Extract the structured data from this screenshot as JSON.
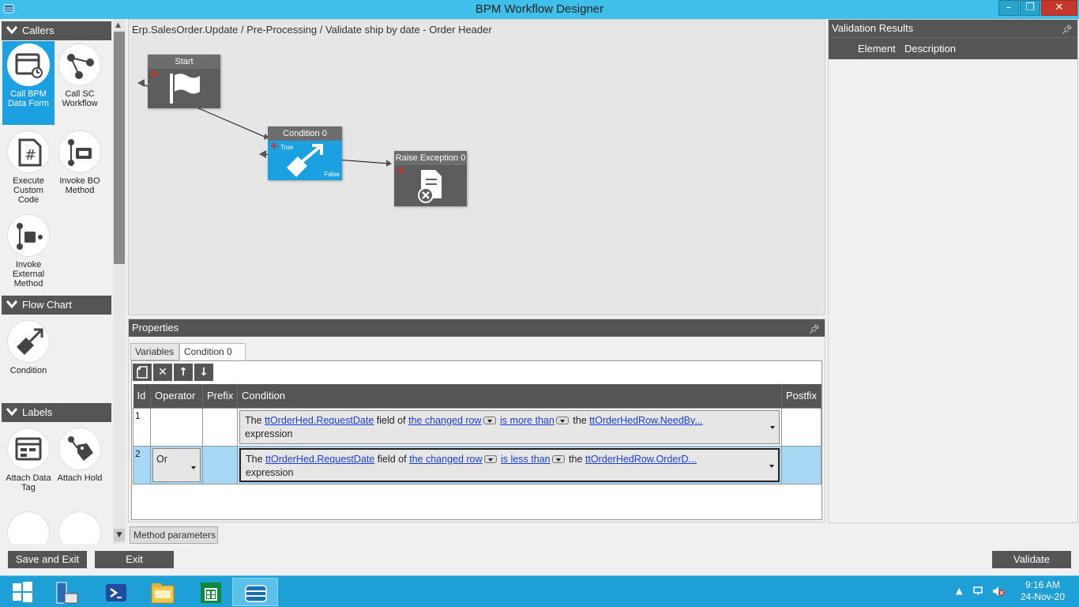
{
  "window": {
    "title": "BPM Workflow Designer",
    "min": "–",
    "max": "❐",
    "close": "✕"
  },
  "toolbox": {
    "sections": [
      {
        "label": "Callers"
      },
      {
        "label": "Flow Chart"
      },
      {
        "label": "Labels"
      }
    ],
    "tools": {
      "call_bpm": "Call BPM Data Form",
      "call_sc": "Call SC Workflow",
      "execute_code": "Execute Custom Code",
      "invoke_bo": "Invoke BO Method",
      "invoke_ext": "Invoke External Method",
      "condition": "Condition",
      "attach_tag": "Attach Data Tag",
      "attach_hold": "Attach Hold"
    }
  },
  "canvas": {
    "breadcrumb": "Erp.SalesOrder.Update / Pre-Processing / Validate ship by date - Order Header",
    "nodes": {
      "start": "Start",
      "condition": "Condition 0",
      "condition_true": "True",
      "condition_false": "False",
      "raise": "Raise Exception 0"
    }
  },
  "properties": {
    "title": "Properties",
    "tabs": [
      "Variables",
      "Condition 0"
    ],
    "columns": [
      "Id",
      "Operator",
      "Prefix",
      "Condition",
      "Postfix"
    ],
    "rows": [
      {
        "id": "1",
        "operator": "",
        "prefix": "",
        "t1": "The",
        "field": "ttOrderHed.RequestDate",
        "t2": "field of",
        "row": "the changed row",
        "cmp": "is more than",
        "t3": "the",
        "expr": "ttOrderHedRow.NeedBy...",
        "t4": "expression",
        "postfix": ""
      },
      {
        "id": "2",
        "operator": "Or",
        "prefix": "",
        "t1": "The",
        "field": "ttOrderHed.RequestDate",
        "t2": "field of",
        "row": "the changed row",
        "cmp": "is less than",
        "t3": "the",
        "expr": "ttOrderHedRow.OrderD...",
        "t4": "expression",
        "postfix": ""
      }
    ],
    "method_params": "Method parameters"
  },
  "validation": {
    "title": "Validation Results",
    "columns": [
      "Element",
      "Description"
    ]
  },
  "buttons": {
    "save_exit": "Save and Exit",
    "exit": "Exit",
    "validate": "Validate"
  },
  "taskbar": {
    "time": "9:16 AM",
    "date": "24-Nov-20"
  },
  "colors": {
    "accent": "#1ba1e2",
    "titlebar": "#3ec0ea",
    "panel_header": "#555555",
    "taskbar": "#1e9fd6",
    "selected_row": "#a6d8f3"
  }
}
